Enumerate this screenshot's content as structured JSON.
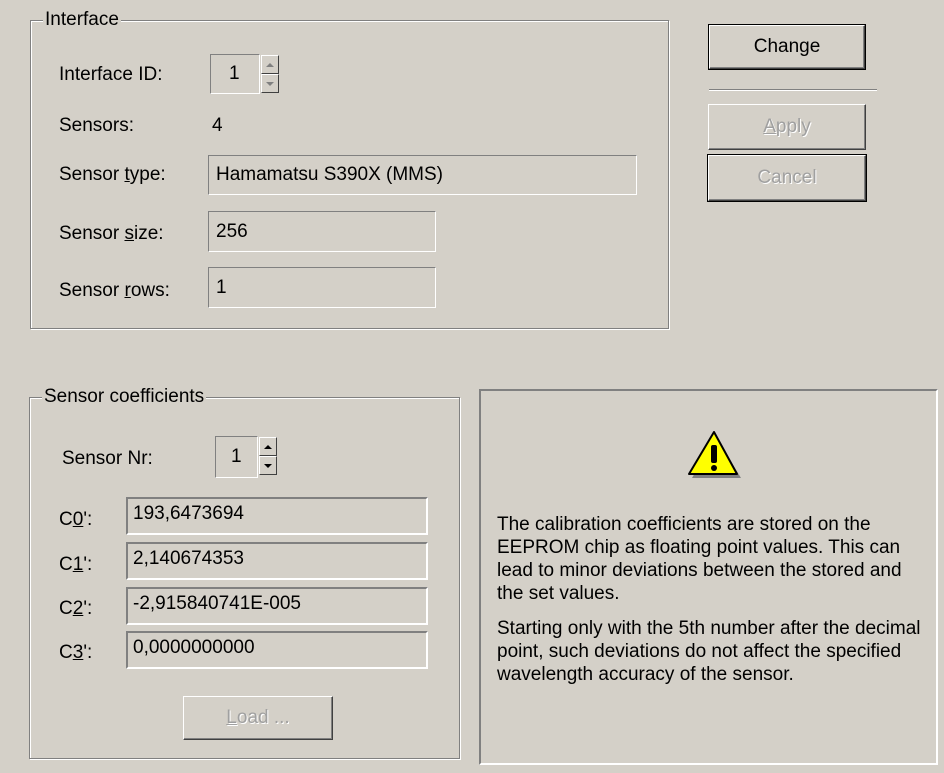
{
  "interface": {
    "group_title": "Interface",
    "id_label": "Interface ID:",
    "id_value": "1",
    "sensors_label": "Sensors:",
    "sensors_value": "4",
    "sensor_type_label_pre": "Sensor ",
    "sensor_type_label_ul": "t",
    "sensor_type_label_post": "ype:",
    "sensor_type_value": "Hamamatsu S390X (MMS)",
    "sensor_size_label_pre": "Sensor ",
    "sensor_size_label_ul": "s",
    "sensor_size_label_post": "ize:",
    "sensor_size_value": "256",
    "sensor_rows_label_pre": "Sensor ",
    "sensor_rows_label_ul": "r",
    "sensor_rows_label_post": "ows:",
    "sensor_rows_value": "1"
  },
  "buttons": {
    "change": "Change",
    "apply_ul": "A",
    "apply_rest": "pply",
    "cancel": "Cancel"
  },
  "coefficients": {
    "group_title": "Sensor coefficients",
    "sensor_nr_label": "Sensor Nr:",
    "sensor_nr_value": "1",
    "rows": [
      {
        "pre": "C",
        "ul": "0",
        "post": "':",
        "value": "193,6473694"
      },
      {
        "pre": "C",
        "ul": "1",
        "post": "':",
        "value": "2,140674353"
      },
      {
        "pre": "C",
        "ul": "2",
        "post": "':",
        "value": "-2,915840741E-005"
      },
      {
        "pre": "C",
        "ul": "3",
        "post": "':",
        "value": "0,0000000000"
      }
    ],
    "load_ul": "L",
    "load_rest": "oad ..."
  },
  "info": {
    "icon": "warning-icon",
    "paragraph1": "The calibration coefficients are stored on the EEPROM chip as floating point values. This can lead to minor deviations between the stored and the set values.",
    "paragraph2": "Starting only with the 5th number after the decimal point, such deviations do not affect the specified wavelength accuracy of the sensor."
  },
  "colors": {
    "face": "#d4d0c8",
    "shadow": "#808080",
    "highlight": "#ffffff",
    "warning_yellow": "#ffff00"
  }
}
